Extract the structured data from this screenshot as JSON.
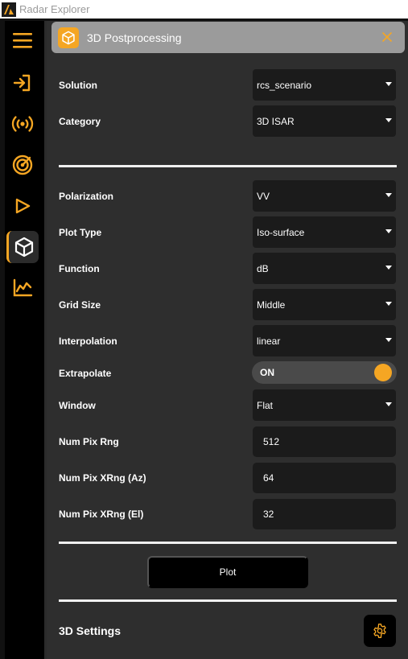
{
  "window": {
    "title": "Radar Explorer"
  },
  "sidebar": {
    "items": [
      {
        "icon": "menu-icon"
      },
      {
        "icon": "import-icon"
      },
      {
        "icon": "broadcast-icon"
      },
      {
        "icon": "radar-target-icon"
      },
      {
        "icon": "play-icon"
      },
      {
        "icon": "cube-icon",
        "active": true
      },
      {
        "icon": "line-chart-icon"
      }
    ]
  },
  "panel": {
    "title": "3D Postprocessing",
    "icon": "cube-icon",
    "close_icon": "close-icon"
  },
  "fields": {
    "solution": {
      "label": "Solution",
      "value": "rcs_scenario"
    },
    "category": {
      "label": "Category",
      "value": "3D ISAR"
    },
    "polarization": {
      "label": "Polarization",
      "value": "VV"
    },
    "plot_type": {
      "label": "Plot Type",
      "value": "Iso-surface"
    },
    "function": {
      "label": "Function",
      "value": "dB"
    },
    "grid_size": {
      "label": "Grid Size",
      "value": "Middle"
    },
    "interpolation": {
      "label": "Interpolation",
      "value": "linear"
    },
    "extrapolate": {
      "label": "Extrapolate",
      "value": "ON",
      "on": true
    },
    "window": {
      "label": "Window",
      "value": "Flat"
    },
    "num_pix_rng": {
      "label": "Num Pix Rng",
      "value": "512"
    },
    "num_pix_xrng_az": {
      "label": "Num Pix XRng (Az)",
      "value": "64"
    },
    "num_pix_xrng_el": {
      "label": "Num Pix XRng (El)",
      "value": "32"
    }
  },
  "actions": {
    "plot_label": "Plot"
  },
  "settings": {
    "title": "3D Settings",
    "icon": "gear-icon"
  },
  "colors": {
    "accent": "#f5a623",
    "background": "#2e2e2e",
    "sidebar": "#000000",
    "field": "#1b1b1b",
    "header": "#9b9b9b"
  }
}
